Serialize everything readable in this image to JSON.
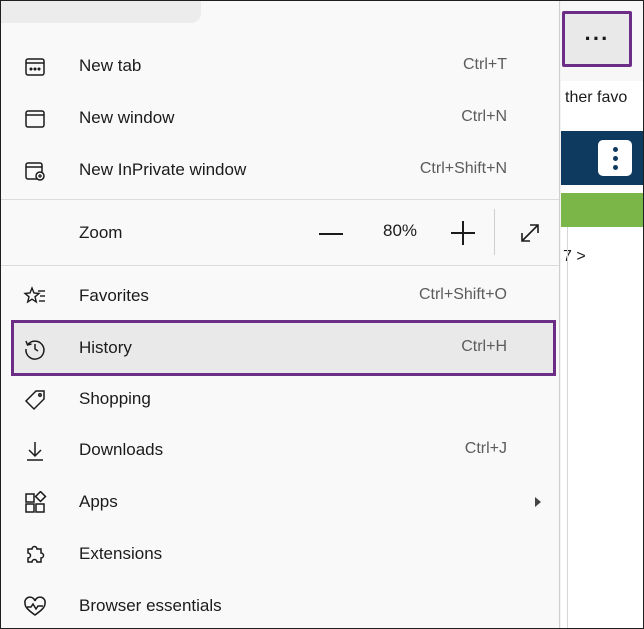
{
  "right_panel": {
    "more_button": "···",
    "favorites_text": "ther favo",
    "page_number": "7  >"
  },
  "menu": {
    "items": [
      {
        "name": "new-tab",
        "label": "New tab",
        "shortcut": "Ctrl+T",
        "icon": "new-tab-icon"
      },
      {
        "name": "new-window",
        "label": "New window",
        "shortcut": "Ctrl+N",
        "icon": "window-icon"
      },
      {
        "name": "new-inprivate-window",
        "label": "New InPrivate window",
        "shortcut": "Ctrl+Shift+N",
        "icon": "inprivate-icon"
      },
      {
        "name": "favorites",
        "label": "Favorites",
        "shortcut": "Ctrl+Shift+O",
        "icon": "favorites-icon"
      },
      {
        "name": "history",
        "label": "History",
        "shortcut": "Ctrl+H",
        "icon": "history-icon"
      },
      {
        "name": "shopping",
        "label": "Shopping",
        "shortcut": "",
        "icon": "tag-icon"
      },
      {
        "name": "downloads",
        "label": "Downloads",
        "shortcut": "Ctrl+J",
        "icon": "download-icon"
      },
      {
        "name": "apps",
        "label": "Apps",
        "shortcut": "",
        "icon": "apps-icon"
      },
      {
        "name": "extensions",
        "label": "Extensions",
        "shortcut": "",
        "icon": "puzzle-icon"
      },
      {
        "name": "browser-essentials",
        "label": "Browser essentials",
        "shortcut": "",
        "icon": "heart-pulse-icon"
      }
    ],
    "zoom": {
      "label": "Zoom",
      "value": "80%"
    }
  },
  "colors": {
    "highlight": "#6b2d86",
    "nav_bar": "#0f3a5f",
    "green_bar": "#7ab648"
  }
}
